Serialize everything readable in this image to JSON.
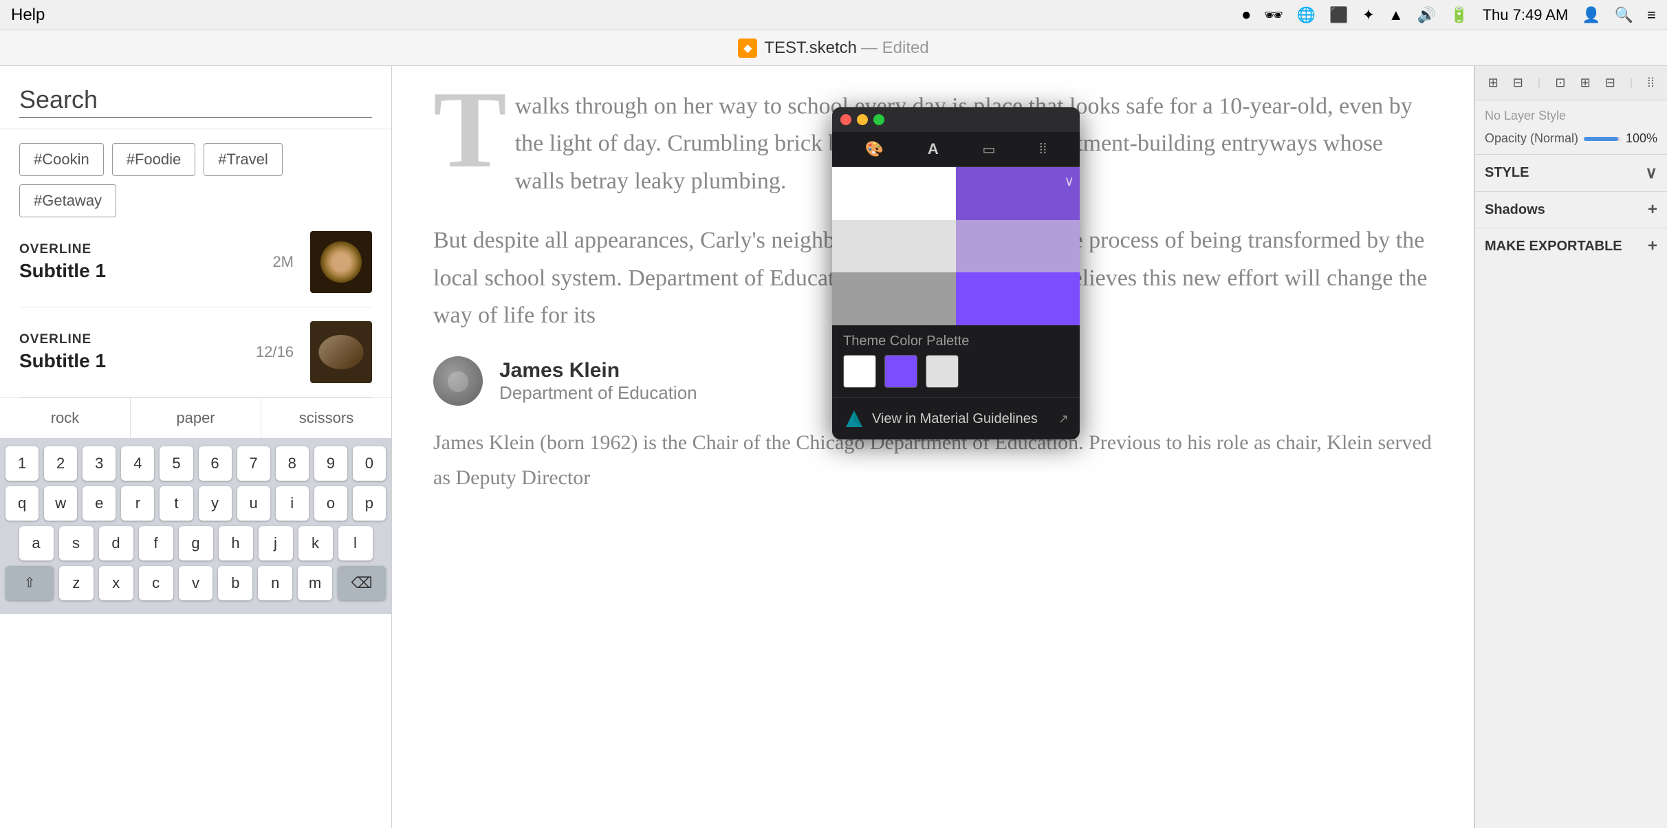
{
  "menubar": {
    "help": "Help",
    "time": "Thu 7:49 AM"
  },
  "titlebar": {
    "filename": "TEST.sketch",
    "status": "— Edited"
  },
  "leftPanel": {
    "search": {
      "label": "Search",
      "placeholder": "Search"
    },
    "hashtags": [
      "#Cookin",
      "#Foodie",
      "#Travel",
      "#Getaway"
    ],
    "listItems": [
      {
        "overline": "OVERLINE",
        "subtitle": "Subtitle 1",
        "meta": "2M",
        "imageType": "bowl"
      },
      {
        "overline": "OVERLINE",
        "subtitle": "Subtitle 1",
        "meta": "12/16",
        "imageType": "nuts"
      }
    ],
    "bottomTabs": [
      "rock",
      "paper",
      "scissors"
    ],
    "keyboard": {
      "row1": [
        "1",
        "2",
        "3",
        "4",
        "5",
        "6",
        "7",
        "8",
        "9",
        "0"
      ],
      "row2": [
        "q",
        "w",
        "e",
        "r",
        "t",
        "y",
        "u",
        "i",
        "o",
        "p"
      ],
      "row3": [
        "a",
        "s",
        "d",
        "f",
        "g",
        "h",
        "j",
        "k",
        "l"
      ],
      "row4": [
        "z",
        "x",
        "c",
        "v",
        "b",
        "n",
        "m"
      ]
    }
  },
  "centerPanel": {
    "dropcap": "T",
    "paragraphs": [
      "walks through on her way to school every day is place that looks safe for a 10-year-old, even by the light of day. Crumbling brick buildings give way to apartment-building entryways whose walls betray leaky plumbing.",
      "But despite all appearances, Carly's neighborhood is one that is in the process of being transformed by the local school system. Department of Education chair, James Klein, believes this new effort will change the way of life for its"
    ],
    "author": {
      "name": "James Klein",
      "title": "Department of Education"
    },
    "bodyText": "James Klein (born 1962) is the Chair of the Chicago Department of Education. Previous to his role as chair, Klein served as Deputy Director"
  },
  "colorPanel": {
    "themeLabel": "Theme Color Palette",
    "materialLinkText": "View in Material Guidelines",
    "swatches": [
      "white",
      "purple",
      "lightgray"
    ],
    "tools": [
      "palette",
      "A",
      "rect",
      "dots"
    ],
    "colorGrid": [
      {
        "color": "#ffffff"
      },
      {
        "color": "#7b52d3"
      },
      {
        "color": "#e0e0e0"
      },
      {
        "color": "#b39ddb"
      },
      {
        "color": "#9e9e9e"
      },
      {
        "color": "#7c4dff"
      }
    ]
  },
  "rightPanel": {
    "layerStyle": "No Layer Style",
    "opacityLabel": "Opacity (Normal)",
    "opacityValue": "100%",
    "styleLabel": "STYLE",
    "shadowsLabel": "Shadows",
    "exportLabel": "MAKE EXPORTABLE"
  }
}
